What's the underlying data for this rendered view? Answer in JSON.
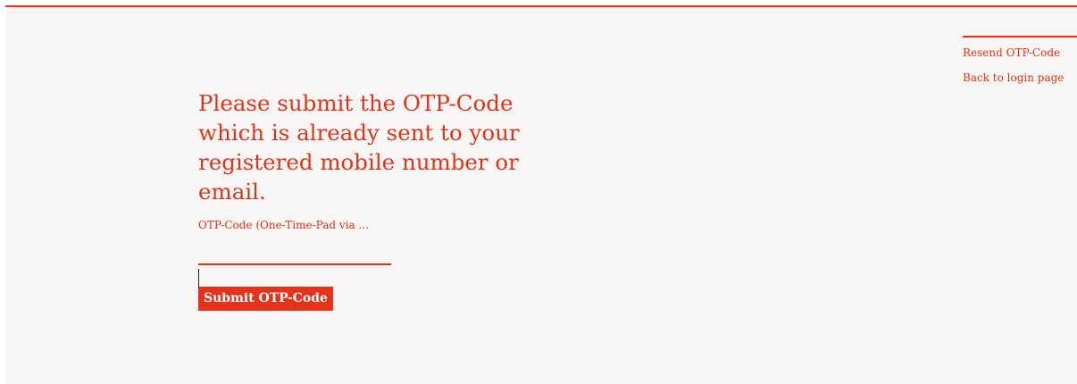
{
  "side_links": {
    "resend_label": "Resend OTP-Code",
    "back_label": "Back to login page"
  },
  "form": {
    "heading": "Please submit the OTP-Code which is already sent to your registered mobile number or email.",
    "field_label": "OTP-Code (One-Time-Pad via ...",
    "field_value": "",
    "submit_label": "Submit OTP-Code"
  },
  "colors": {
    "accent": "#e4321b",
    "background": "#f7f6f4"
  }
}
